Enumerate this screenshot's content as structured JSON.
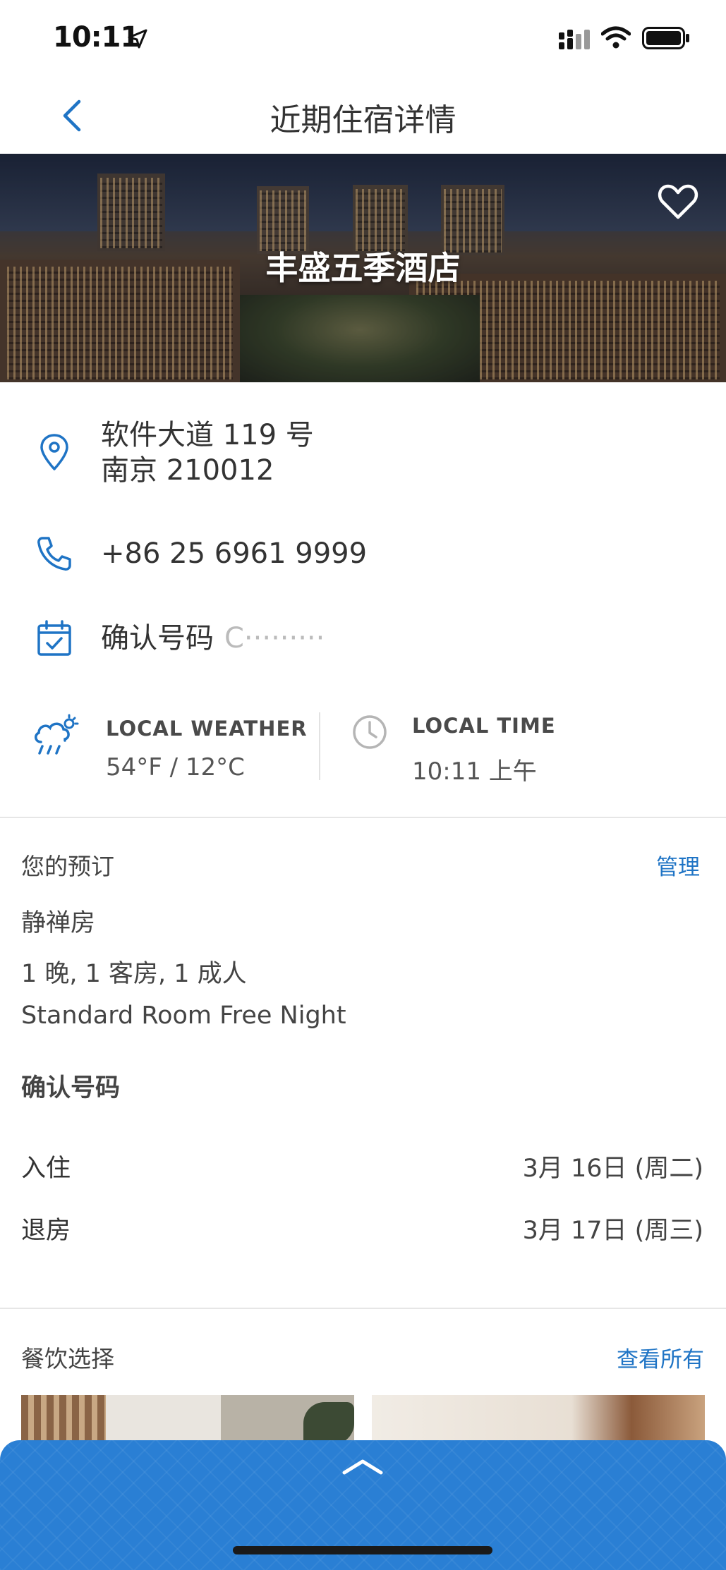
{
  "status_bar": {
    "time": "10:11"
  },
  "nav": {
    "title": "近期住宿详情"
  },
  "hotel": {
    "name": "丰盛五季酒店",
    "address_line1": "软件大道 119 号",
    "address_line2": "南京 210012",
    "phone": "+86 25 6961 9999",
    "confirmation_label": "确认号码",
    "confirmation_value": "C·········"
  },
  "weather": {
    "label": "LOCAL WEATHER",
    "value": "54°F / 12°C"
  },
  "local_time": {
    "label": "LOCAL TIME",
    "value": "10:11 上午"
  },
  "booking": {
    "title": "您的预订",
    "manage_label": "管理",
    "room_type": "静禅房",
    "summary": "1 晚, 1 客房, 1  成人",
    "rate": "Standard Room Free Night",
    "confirmation_label": "确认号码",
    "confirmation_value": "",
    "checkin_label": "入住",
    "checkin_value": "3月 16日 (周二)",
    "checkout_label": "退房",
    "checkout_value": "3月 17日 (周三)"
  },
  "dining": {
    "title": "餐饮选择",
    "view_all_label": "查看所有"
  },
  "colors": {
    "accent": "#1f74c5",
    "drawer": "#2a7fd4"
  },
  "icons": [
    "navigation-arrow-icon",
    "signal-icon",
    "wifi-icon",
    "battery-icon",
    "back-chevron-icon",
    "heart-icon",
    "location-pin-icon",
    "phone-icon",
    "calendar-check-icon",
    "weather-icon",
    "clock-icon",
    "chevron-up-icon"
  ]
}
